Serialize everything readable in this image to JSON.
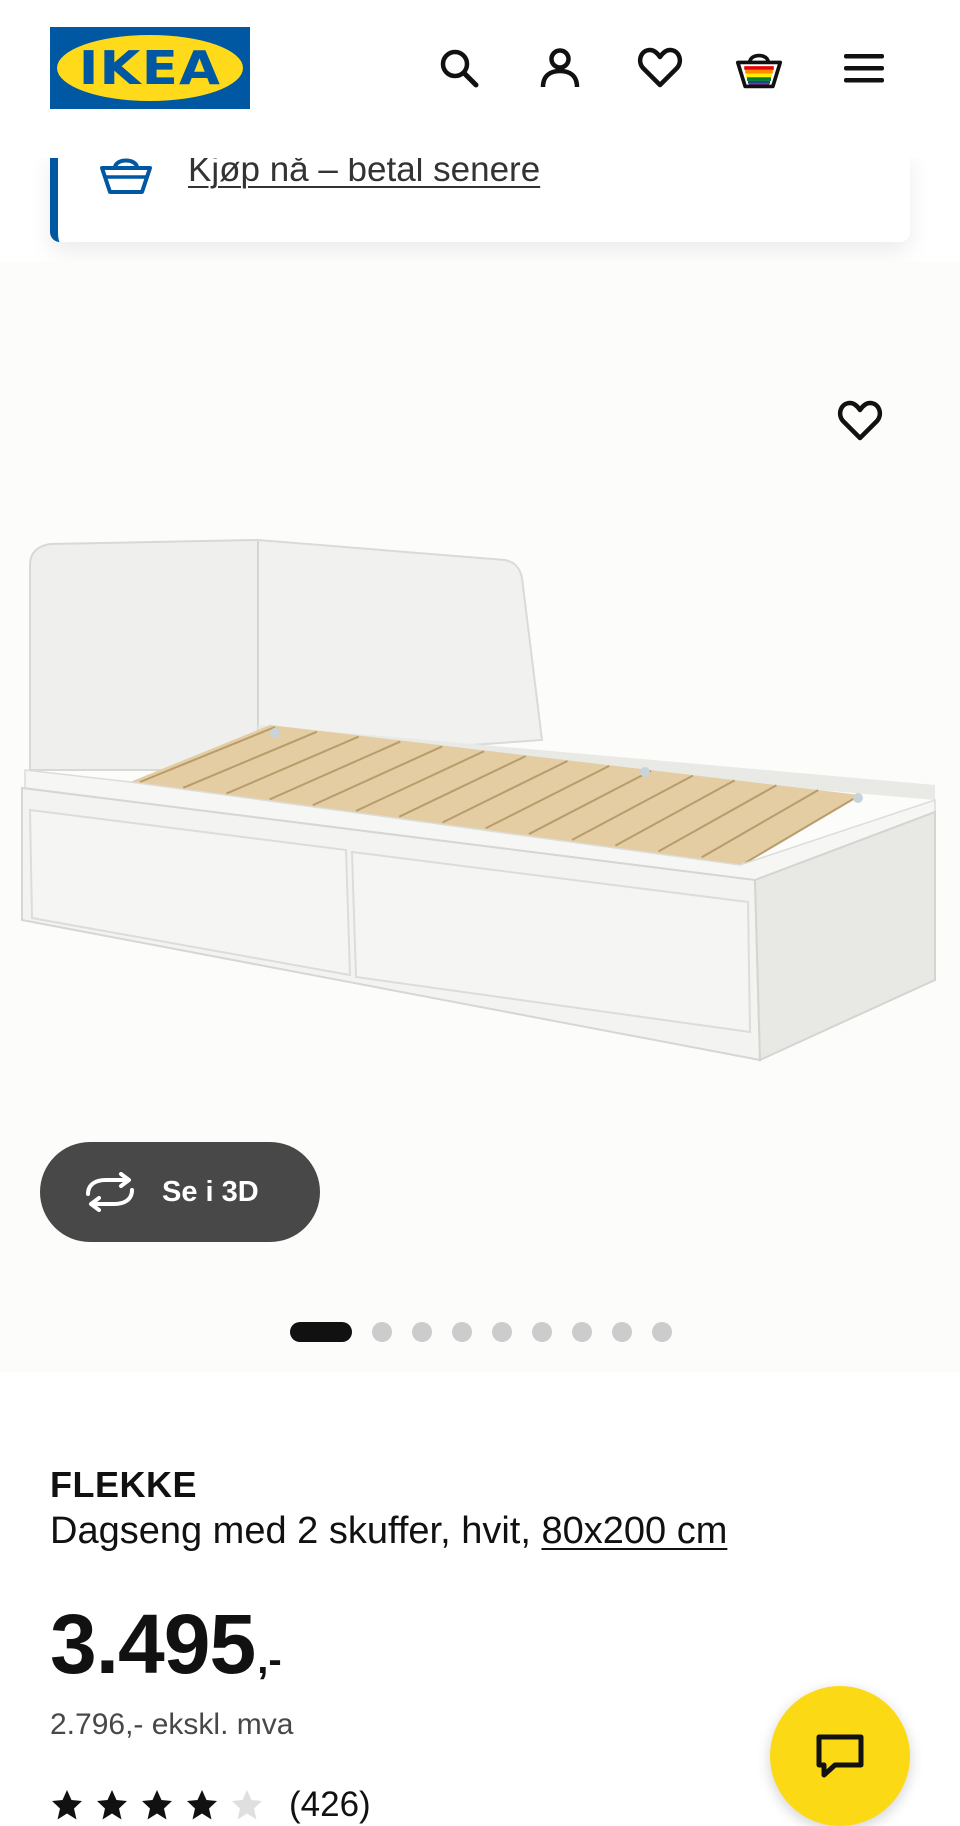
{
  "header": {
    "logo_text": "IKEA",
    "icons": [
      "search-icon",
      "account-icon",
      "heart-icon",
      "shopping-bag-icon",
      "menu-icon"
    ]
  },
  "promo": {
    "text": "Kjøp nå – betal senere",
    "icon": "basket-icon"
  },
  "gallery": {
    "three_d_label": "Se i 3D",
    "image_count": 9,
    "active_index": 0
  },
  "product": {
    "brand": "FLEKKE",
    "description": "Dagseng med 2 skuffer, hvit,",
    "size": "80x200 cm",
    "price": "3.495",
    "price_suffix": ",-",
    "price_ex_vat": "2.796,- ekskl. mva",
    "rating": 4,
    "rating_max": 5,
    "rating_count": "(426)"
  },
  "colors": {
    "brand_blue": "#0058a3",
    "brand_yellow": "#ffda1a",
    "chat_yellow": "#fbd914",
    "button_dark": "#484848"
  }
}
